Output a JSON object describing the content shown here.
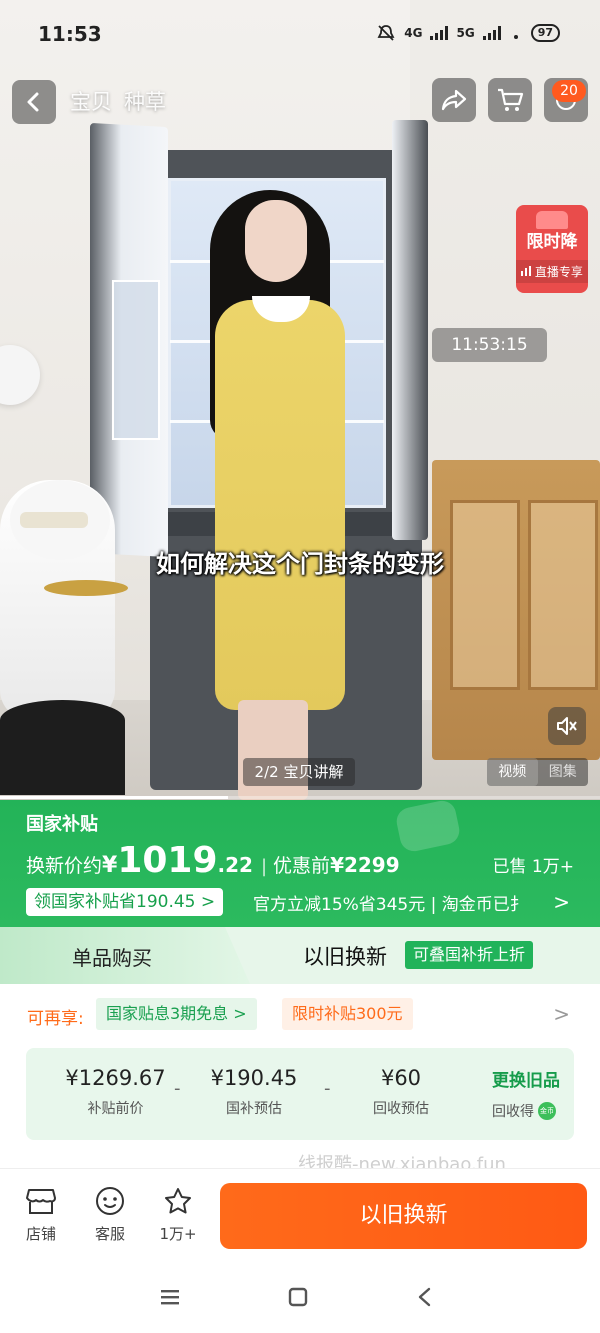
{
  "status_bar": {
    "time": "11:53",
    "network_4g": "4G",
    "network_5g": "5G",
    "battery": "97"
  },
  "nav": {
    "tabs": [
      "宝贝",
      "种草"
    ],
    "cart_count": "20"
  },
  "video": {
    "promo_title": "限时降",
    "promo_subtitle": "直播专享",
    "timestamp": "11:53:15",
    "subtitle": "如何解决这个门封条的变形",
    "page_indicator": "2/2 宝贝讲解",
    "media_tabs": [
      "视频",
      "图集"
    ],
    "progress": 0.38
  },
  "subsidy": {
    "title": "国家补贴",
    "price_label": "换新价约",
    "currency": "¥",
    "price_int": "1019",
    "price_dec": ".22",
    "separator": "|",
    "original_label": "优惠前",
    "original_price": "¥2299",
    "sold": "已售 1万+",
    "claim_button": "领国家补贴省190.45 >",
    "promo_line": "官方立减15%省345元 | 淘金币已扌",
    "arrow": ">"
  },
  "options": {
    "single_purchase": "单品购买",
    "trade_in": "以旧换新",
    "trade_in_badge": "可叠国补折上折"
  },
  "benefits": {
    "label": "可再享:",
    "chip_1": "国家贴息3期免息 >",
    "chip_2": "限时补贴300元",
    "arrow": ">"
  },
  "breakdown": {
    "items": [
      {
        "value": "¥1269.67",
        "label": "补贴前价"
      },
      {
        "value": "¥190.45",
        "label": "国补预估"
      },
      {
        "value": "¥60",
        "label": "回收预估"
      }
    ],
    "operators": [
      "-",
      "-"
    ],
    "action_label": "更换旧品",
    "action_sub": "回收得",
    "coin_text": "金币"
  },
  "watermark": "线报酷-new.xianbao.fun",
  "bottom_bar": {
    "store": "店铺",
    "service": "客服",
    "favorites": "1万+",
    "main_button": "以旧换新"
  },
  "colors": {
    "brand_green": "#23b358",
    "accent_orange": "#ff6a1a",
    "promo_red": "#e83e3e"
  },
  "icons": [
    "back-icon",
    "share-icon",
    "cart-icon",
    "mute-icon",
    "store-icon",
    "service-icon",
    "star-icon",
    "menu-icon",
    "home-icon",
    "back-nav-icon"
  ]
}
